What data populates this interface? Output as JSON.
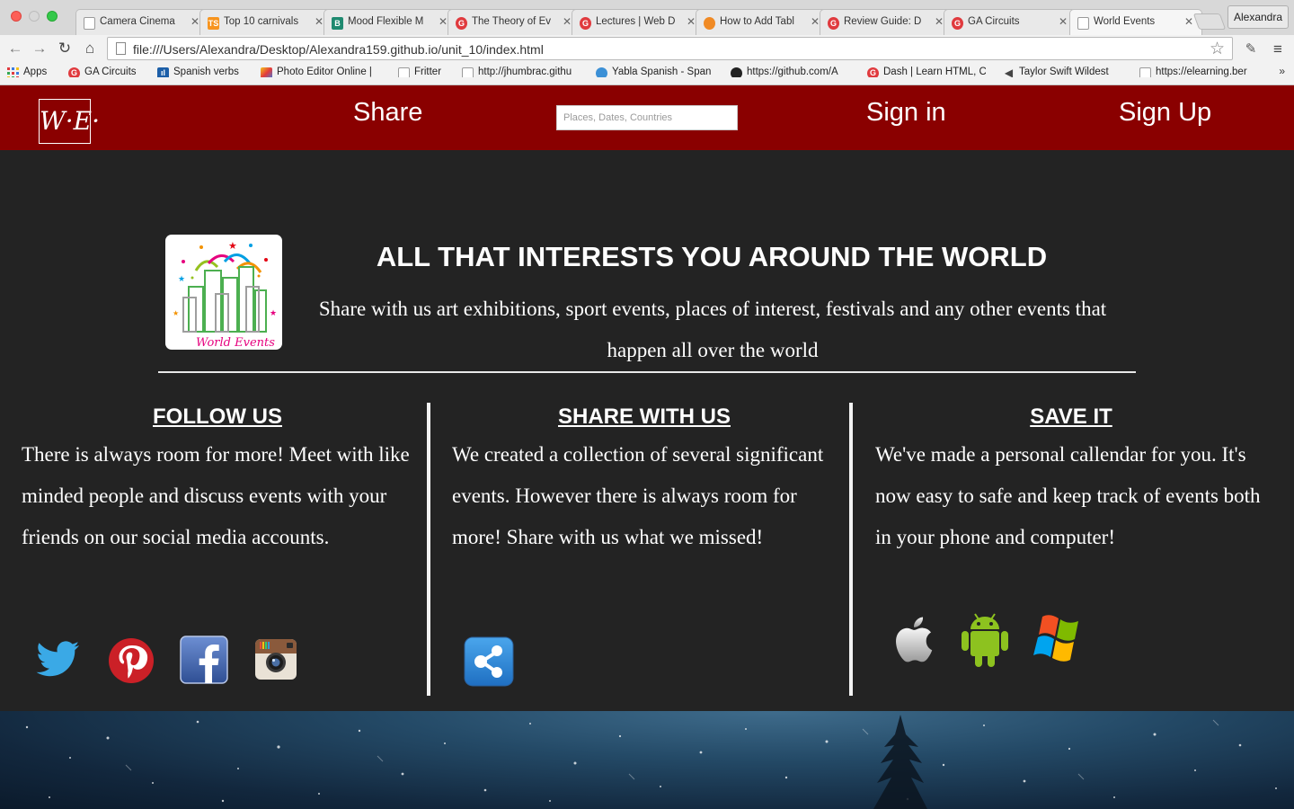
{
  "browser": {
    "profile_name": "Alexandra",
    "url": "file:///Users/Alexandra/Desktop/Alexandra159.github.io/unit_10/index.html",
    "tabs": [
      {
        "label": "Camera Cinema",
        "icon": "page-icon"
      },
      {
        "label": "Top 10 carnivals",
        "icon": "ts-icon"
      },
      {
        "label": "Mood Flexible M",
        "icon": "b-icon"
      },
      {
        "label": "The Theory of Ev",
        "icon": "ga-icon"
      },
      {
        "label": "Lectures | Web D",
        "icon": "ga-icon"
      },
      {
        "label": "How to Add Tabl",
        "icon": "rss-icon"
      },
      {
        "label": "Review Guide: D",
        "icon": "ga-icon"
      },
      {
        "label": "GA Circuits",
        "icon": "ga-icon"
      },
      {
        "label": "World Events",
        "icon": "page-icon",
        "active": true
      }
    ],
    "bookmarks": [
      {
        "label": "Apps"
      },
      {
        "label": "GA Circuits"
      },
      {
        "label": "Spanish verbs"
      },
      {
        "label": "Photo Editor Online |"
      },
      {
        "label": "Fritter"
      },
      {
        "label": "http://jhumbrac.githu"
      },
      {
        "label": "Yabla Spanish - Span"
      },
      {
        "label": "https://github.com/A"
      },
      {
        "label": "Dash | Learn HTML, C"
      },
      {
        "label": "Taylor Swift Wildest"
      },
      {
        "label": "https://elearning.ber"
      }
    ],
    "bookmarks_more": "»"
  },
  "header": {
    "logo_text": "W·E·",
    "share_label": "Share",
    "search_placeholder": "Places, Dates, Countries",
    "signin_label": "Sign in",
    "signup_label": "Sign Up",
    "background": "#8a0000"
  },
  "hero": {
    "logo_caption": "World Events",
    "title": "ALL THAT INTERESTS YOU AROUND THE WORLD",
    "text": "Share with us art exhibitions, sport events, places of interest, festivals and any other events that happen all over the world"
  },
  "columns": [
    {
      "heading": "FOLLOW US",
      "text": "There is always room for more! Meet with like minded people and discuss events with your friends on our social media accounts.",
      "icons": [
        "twitter-icon",
        "pinterest-icon",
        "facebook-icon",
        "instagram-icon"
      ]
    },
    {
      "heading": "SHARE WITH US",
      "text": "We created a collection of several significant events. However there is always room for more! Share with us what we missed!",
      "icons": [
        "share-icon"
      ]
    },
    {
      "heading": "SAVE IT",
      "text": "We've made a personal callendar for you. It's now easy to safe and keep track of events both in your phone and computer!",
      "icons": [
        "apple-icon",
        "android-icon",
        "windows-icon"
      ]
    }
  ],
  "colors": {
    "page_background": "#232323",
    "header_red": "#8a0000",
    "text": "#ffffff"
  }
}
